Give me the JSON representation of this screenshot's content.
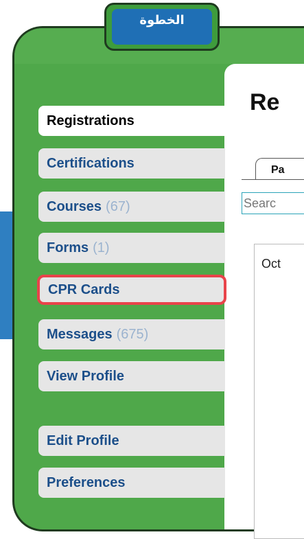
{
  "badge": {
    "title": "الخطوة"
  },
  "page": {
    "heading": "Re"
  },
  "tabs": [
    {
      "label": "Pa"
    }
  ],
  "search": {
    "text": "Searc"
  },
  "list": {
    "first_item": "Oct"
  },
  "colors": {
    "frame_green": "#4fa84a",
    "badge_blue": "#1f6fb5",
    "link_blue": "#1c4f8a",
    "highlight_red": "#e8434a",
    "count_gray": "#9bb3cf"
  },
  "nav": {
    "items": [
      {
        "label": "Registrations",
        "count": null,
        "active": true
      },
      {
        "label": "Certifications",
        "count": null
      },
      {
        "label": "Courses",
        "count": "(67)"
      },
      {
        "label": "Forms",
        "count": "(1)"
      },
      {
        "label": "CPR Cards",
        "count": null,
        "highlighted": true
      },
      {
        "label": "Messages",
        "count": "(675)"
      },
      {
        "label": "View Profile",
        "count": null
      },
      {
        "label": "Edit Profile",
        "count": null
      },
      {
        "label": "Preferences",
        "count": null
      }
    ]
  }
}
